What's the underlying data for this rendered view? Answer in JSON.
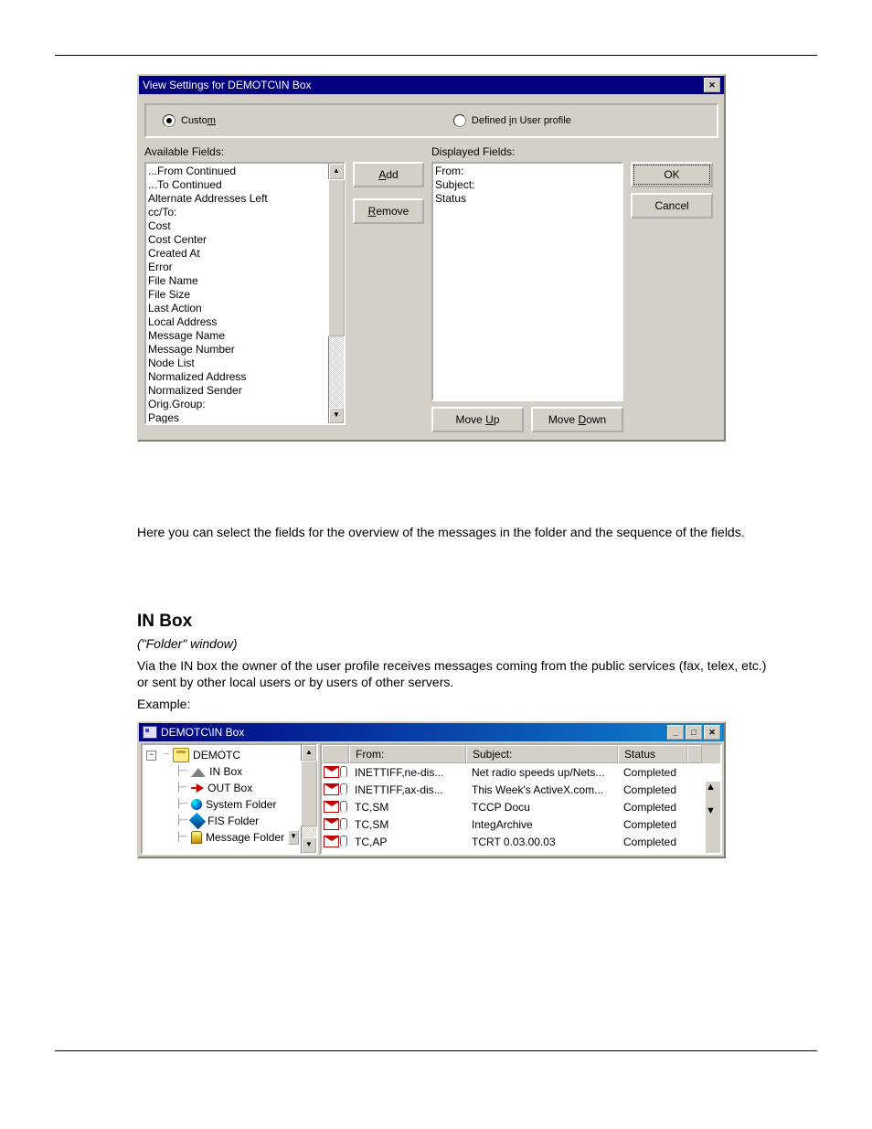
{
  "dialog1": {
    "title": "View Settings for DEMOTC\\IN Box",
    "radio": {
      "custom": "Custom",
      "defined": "Defined in User profile"
    },
    "labels": {
      "available": "Available Fields:",
      "displayed": "Displayed Fields:"
    },
    "available_fields": [
      "...From Continued",
      "...To Continued",
      "Alternate Addresses Left",
      "cc/To:",
      "Cost",
      "Cost Center",
      "Created At",
      "Error",
      "File Name",
      "File Size",
      "Last Action",
      "Local Address",
      "Message Name",
      "Message Number",
      "Node List",
      "Normalized Address",
      "Normalized Sender",
      "Orig.Group:",
      "Pages"
    ],
    "displayed_fields": [
      "From:",
      "Subject:",
      "Status"
    ],
    "buttons": {
      "add": "Add",
      "remove": "Remove",
      "ok": "OK",
      "cancel": "Cancel",
      "moveup": "Move Up",
      "movedown": "Move Down"
    }
  },
  "copy": {
    "p1": "Here you can select the fields for the overview of the messages in the folder and the sequence of the fields.",
    "h1": "IN Box",
    "sub": "(\"Folder\" window)",
    "p2": "Via the IN box the owner of the user profile receives messages coming from the public services (fax, telex, etc.) or sent by other local users or by users of other servers.",
    "ex": "Example:"
  },
  "win2": {
    "title": "DEMOTC\\IN Box",
    "tree": {
      "root": "DEMOTC",
      "items": [
        "IN Box",
        "OUT Box",
        "System Folder",
        "FIS Folder",
        "Message Folder"
      ]
    },
    "columns": {
      "from": "From:",
      "subject": "Subject:",
      "status": "Status"
    },
    "rows": [
      {
        "from": "INETTIFF,ne-dis...",
        "subject": "Net radio speeds up/Nets...",
        "status": "Completed"
      },
      {
        "from": "INETTIFF,ax-dis...",
        "subject": "This Week's ActiveX.com...",
        "status": "Completed"
      },
      {
        "from": "TC,SM",
        "subject": "TCCP Docu",
        "status": "Completed"
      },
      {
        "from": "TC,SM",
        "subject": "IntegArchive",
        "status": "Completed"
      },
      {
        "from": "TC,AP",
        "subject": "TCRT 0.03.00.03",
        "status": "Completed"
      }
    ]
  }
}
